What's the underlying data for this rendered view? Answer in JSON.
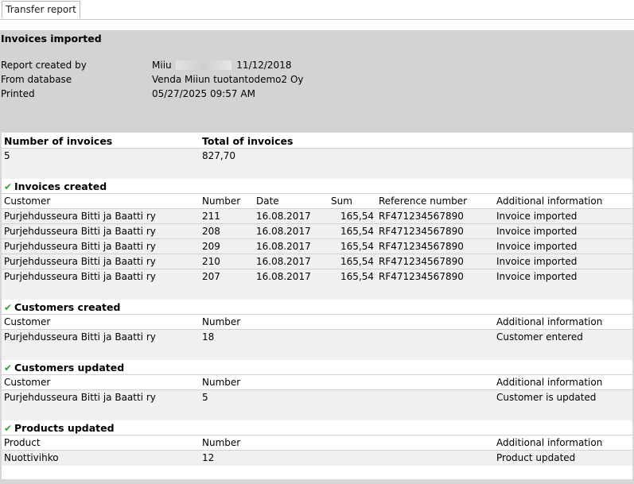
{
  "tab": {
    "label": "Transfer report"
  },
  "report": {
    "title": "Invoices imported",
    "meta": [
      {
        "label": "Report created by",
        "value_prefix": "Miiu",
        "value_suffix": "11/12/2018"
      },
      {
        "label": "From database",
        "value": "Venda Miiun tuotantodemo2 Oy"
      },
      {
        "label": "Printed",
        "value": "05/27/2025 09:57 AM"
      }
    ]
  },
  "summary": {
    "col_count": "Number of invoices",
    "col_total": "Total of invoices",
    "count": "5",
    "total": "827,70"
  },
  "invoices_created": {
    "title": "Invoices created",
    "headers": [
      "Customer",
      "Number",
      "Date",
      "Sum",
      "Reference number",
      "Additional information"
    ],
    "rows": [
      [
        "Purjehdusseura Bitti ja Baatti ry",
        "211",
        "16.08.2017",
        "165,54",
        "RF471234567890",
        "Invoice imported"
      ],
      [
        "Purjehdusseura Bitti ja Baatti ry",
        "208",
        "16.08.2017",
        "165,54",
        "RF471234567890",
        "Invoice imported"
      ],
      [
        "Purjehdusseura Bitti ja Baatti ry",
        "209",
        "16.08.2017",
        "165,54",
        "RF471234567890",
        "Invoice imported"
      ],
      [
        "Purjehdusseura Bitti ja Baatti ry",
        "210",
        "16.08.2017",
        "165,54",
        "RF471234567890",
        "Invoice imported"
      ],
      [
        "Purjehdusseura Bitti ja Baatti ry",
        "207",
        "16.08.2017",
        "165,54",
        "RF471234567890",
        "Invoice imported"
      ]
    ]
  },
  "customers_created": {
    "title": "Customers created",
    "headers": [
      "Customer",
      "Number",
      "Additional information"
    ],
    "rows": [
      [
        "Purjehdusseura Bitti ja Baatti ry",
        "18",
        "Customer entered"
      ]
    ]
  },
  "customers_updated": {
    "title": "Customers updated",
    "headers": [
      "Customer",
      "Number",
      "Additional information"
    ],
    "rows": [
      [
        "Purjehdusseura Bitti ja Baatti ry",
        "5",
        "Customer is updated"
      ]
    ]
  },
  "products_updated": {
    "title": "Products updated",
    "headers": [
      "Product",
      "Number",
      "Additional information"
    ],
    "rows": [
      [
        "Nuottivihko",
        "12",
        "Product updated"
      ]
    ]
  },
  "icons": {
    "section": "check-icon"
  },
  "colors": {
    "header_bg": "#d3d3d3",
    "band": "#eef0f2",
    "check": "#3a9a3a"
  }
}
